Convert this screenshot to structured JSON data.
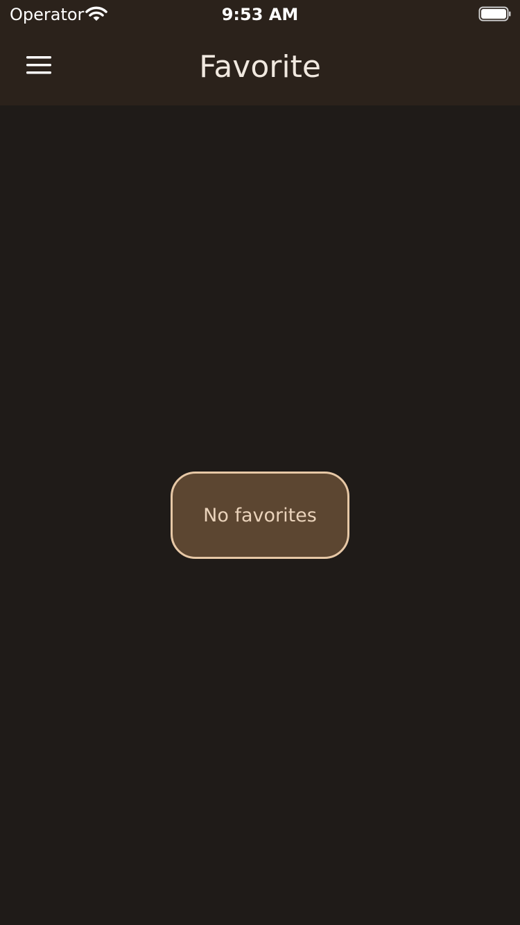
{
  "status_bar": {
    "carrier": "Operator",
    "time": "9:53 AM",
    "wifi_icon": "wifi-icon",
    "battery_icon": "battery-full-icon"
  },
  "nav_bar": {
    "menu_icon": "hamburger-menu-icon",
    "title": "Favorite"
  },
  "main": {
    "empty_message": "No favorites"
  },
  "colors": {
    "background": "#1f1b18",
    "header": "#2b221b",
    "badge_fill": "#5c4631",
    "badge_border": "#e7c8a6",
    "badge_text": "#ead3bb",
    "title_text": "#f0e8df"
  }
}
